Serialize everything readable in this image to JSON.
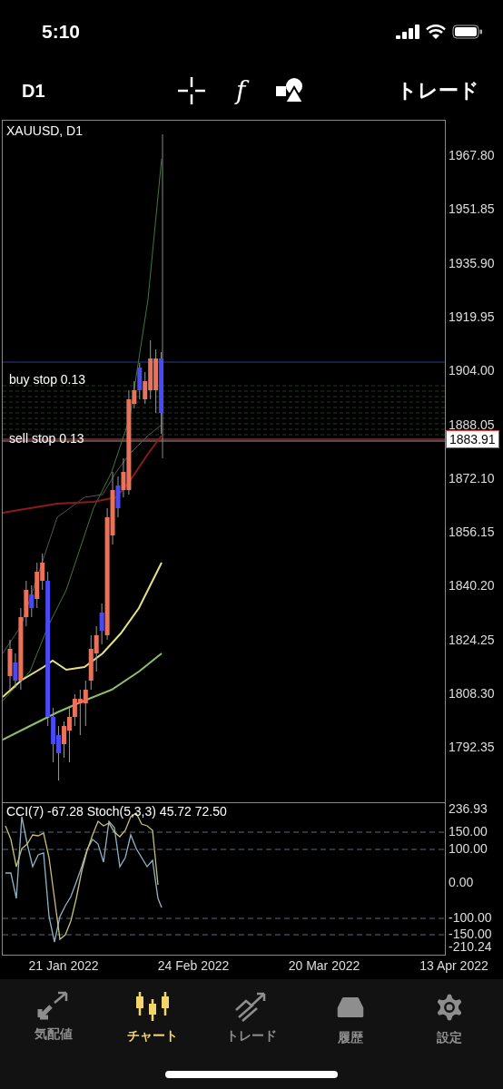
{
  "status_bar": {
    "time": "5:10"
  },
  "toolbar": {
    "timeframe": "D1",
    "function_glyph": "f",
    "trade_button": "トレード"
  },
  "chart": {
    "symbol": "XAUUSD, D1",
    "price_axis": [
      "1967.80",
      "1951.85",
      "1935.90",
      "1919.95",
      "1904.00",
      "1888.05",
      "1872.10",
      "1856.15",
      "1840.20",
      "1824.25",
      "1808.30",
      "1792.35"
    ],
    "current_price": "1883.91",
    "order_labels": [
      "buy stop 0.13",
      "sell stop 0.13"
    ],
    "indicator_legend": "CCI(7) -67.28 Stoch(5,3,3) 45.72 72.50",
    "indicator_axis": [
      "236.93",
      "150.00",
      "100.00",
      "0.00",
      "-100.00",
      "-150.00",
      "-210.24"
    ],
    "dates": [
      "21 Jan 2022",
      "24 Feb 2022",
      "20 Mar 2022",
      "13 Apr 2022"
    ]
  },
  "tab_bar": [
    {
      "label": "気配値",
      "selected": false
    },
    {
      "label": "チャート",
      "selected": true
    },
    {
      "label": "トレード",
      "selected": false
    },
    {
      "label": "履歴",
      "selected": false
    },
    {
      "label": "設定",
      "selected": false
    }
  ]
}
